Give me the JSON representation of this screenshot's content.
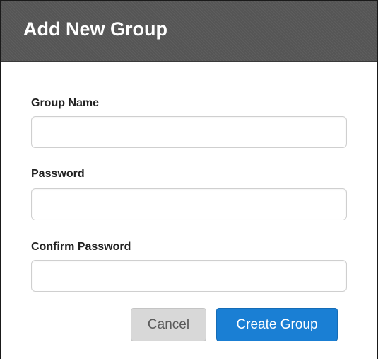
{
  "dialog": {
    "title": "Add New Group",
    "fields": [
      {
        "label": "Group Name",
        "value": ""
      },
      {
        "label": "Password",
        "value": ""
      },
      {
        "label": "Confirm Password",
        "value": ""
      }
    ],
    "buttons": {
      "cancel_label": "Cancel",
      "create_label": "Create Group"
    }
  },
  "colors": {
    "header_bg": "#555555",
    "primary_button": "#1a7fd4",
    "secondary_button": "#d8d8d8"
  }
}
